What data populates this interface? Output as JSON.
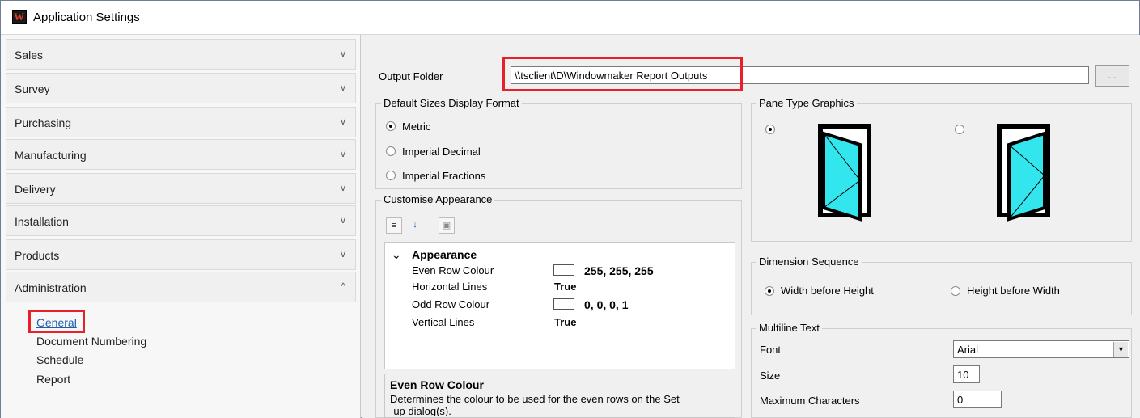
{
  "window": {
    "title": "Application Settings",
    "app_icon_letter": "W"
  },
  "nav": {
    "sections": [
      {
        "label": "Sales",
        "chevron": "v"
      },
      {
        "label": "Survey",
        "chevron": "v"
      },
      {
        "label": "Purchasing",
        "chevron": "v"
      },
      {
        "label": "Manufacturing",
        "chevron": "v"
      },
      {
        "label": "Delivery",
        "chevron": "v"
      },
      {
        "label": "Installation",
        "chevron": "v"
      },
      {
        "label": "Products",
        "chevron": "v"
      },
      {
        "label": "Administration",
        "chevron": "^"
      }
    ],
    "admin_items": [
      "General",
      "Document Numbering",
      "Schedule",
      "Report"
    ],
    "selected": "General"
  },
  "output_folder": {
    "label": "Output Folder",
    "value": "\\\\tsclient\\D\\Windowmaker Report Outputs",
    "browse_label": "..."
  },
  "sizes_format": {
    "title": "Default Sizes Display Format",
    "options": [
      "Metric",
      "Imperial Decimal",
      "Imperial Fractions"
    ],
    "selected": "Metric"
  },
  "customise": {
    "title": "Customise Appearance",
    "toolbar_icons": [
      "categorized-icon",
      "alphabetical-sort-icon",
      "property-pages-icon"
    ],
    "category": "Appearance",
    "properties": [
      {
        "name": "Even Row Colour",
        "value": "255, 255, 255",
        "swatch": "#ffffff"
      },
      {
        "name": "Horizontal Lines",
        "value": "True"
      },
      {
        "name": "Odd Row Colour",
        "value": "0, 0, 0, 1",
        "swatch": "#ffffff"
      },
      {
        "name": "Vertical Lines",
        "value": "True"
      }
    ],
    "description_title": "Even Row Colour",
    "description_text": "Determines the colour to be used for the even rows on the Set",
    "description_text2": "-up dialog(s)."
  },
  "pane_type": {
    "title": "Pane Type Graphics",
    "selected_index": 0,
    "glass_color": "#33e6ee"
  },
  "dimension_sequence": {
    "title": "Dimension Sequence",
    "options": [
      "Width before Height",
      "Height before Width"
    ],
    "selected": "Width before Height"
  },
  "multiline": {
    "title": "Multiline Text",
    "font_label": "Font",
    "font_value": "Arial",
    "size_label": "Size",
    "size_value": "10",
    "max_label": "Maximum Characters",
    "max_value": "0"
  },
  "colors": {
    "highlight": "#e8202a",
    "link": "#1f5fae"
  }
}
